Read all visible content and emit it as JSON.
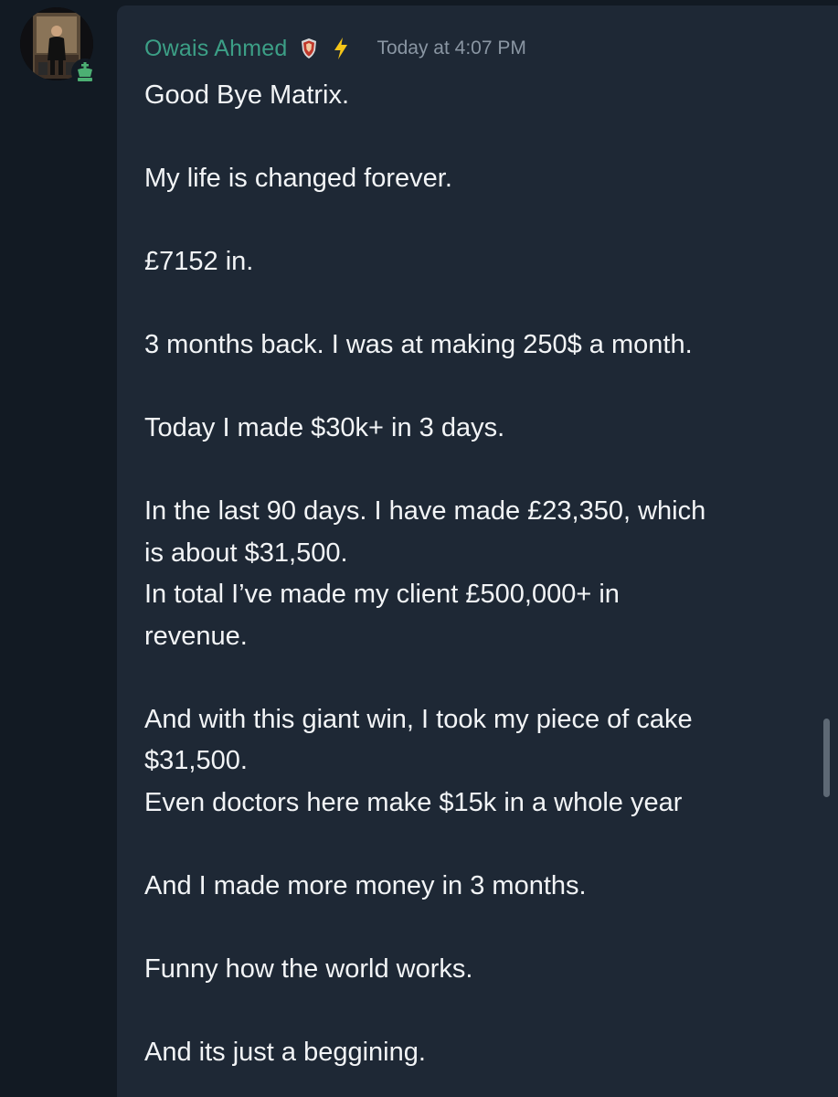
{
  "message": {
    "author": "Owais Ahmed",
    "timestamp": "Today at 4:07 PM",
    "paragraphs": [
      [
        "Good Bye Matrix."
      ],
      [
        "My life is changed forever."
      ],
      [
        "£7152 in."
      ],
      [
        "3 months back. I was at making 250$ a month."
      ],
      [
        "Today I made $30k+ in 3 days."
      ],
      [
        "In the last 90 days. I have made £23,350, which",
        "is about $31,500.",
        "In total I’ve made my client £500,000+ in",
        "revenue."
      ],
      [
        "And with this giant win, I took my piece of cake",
        "$31,500.",
        "Even doctors here make $15k in a whole year"
      ],
      [
        "And I made more money in 3 months."
      ],
      [
        "Funny how the world works."
      ],
      [
        "And its just a beggining."
      ]
    ]
  },
  "icons": {
    "avatar": "user-avatar-photo",
    "avatar_badge": "chess-king-icon",
    "role_badge": "shield-badge-icon",
    "bolt": "lightning-bolt-icon"
  },
  "colors": {
    "background": "#121a23",
    "card": "#1e2835",
    "username": "#3c9f86",
    "timestamp": "#8a96a3",
    "text": "#f2f4f6",
    "badge_green": "#4caf73"
  }
}
